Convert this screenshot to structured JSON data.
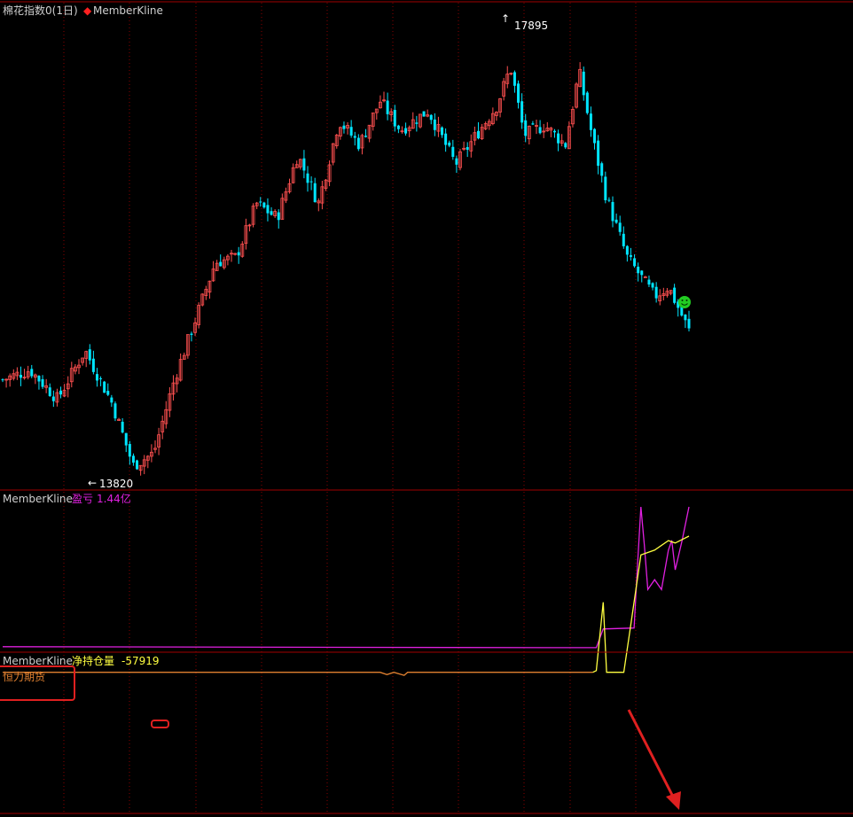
{
  "header": {
    "instrument": "棉花指数0(1日)",
    "indicator_marker": "◆",
    "indicator_name": "MemberKline"
  },
  "price_panel": {
    "high_label": "17895",
    "low_label": "13820",
    "smile_icon": "smiley-face-icon"
  },
  "pnl_panel": {
    "indicator": "MemberKline",
    "label": "盈亏",
    "value": "1.44亿"
  },
  "position_panel": {
    "indicator": "MemberKline",
    "label": "净持仓量",
    "value": "-57919",
    "broker_name": "恒力期货"
  },
  "colors": {
    "up": "#ff5050",
    "down": "#00e5ff",
    "pnl_line": "#e020e0",
    "position_line": "#ffff40",
    "position_line_early": "#e08030",
    "grid": "#8a0000",
    "separator": "#a00000",
    "annotation": "#e02020",
    "smiley": "#22cc22"
  },
  "chart_data": [
    {
      "type": "candlestick",
      "title": "棉花指数0(1日)",
      "ylim": [
        13600,
        18400
      ],
      "annotations": [
        {
          "label": "17895",
          "value": 17895
        },
        {
          "label": "13820",
          "value": 13820
        }
      ],
      "close_path": [
        [
          0,
          14700
        ],
        [
          0.04,
          14800
        ],
        [
          0.08,
          14500
        ],
        [
          0.12,
          15000
        ],
        [
          0.16,
          14450
        ],
        [
          0.19,
          13820
        ],
        [
          0.22,
          13950
        ],
        [
          0.25,
          14700
        ],
        [
          0.28,
          15300
        ],
        [
          0.31,
          15900
        ],
        [
          0.34,
          15950
        ],
        [
          0.37,
          16500
        ],
        [
          0.4,
          16350
        ],
        [
          0.43,
          17000
        ],
        [
          0.46,
          16500
        ],
        [
          0.49,
          17350
        ],
        [
          0.52,
          17100
        ],
        [
          0.55,
          17550
        ],
        [
          0.58,
          17250
        ],
        [
          0.62,
          17450
        ],
        [
          0.66,
          16900
        ],
        [
          0.7,
          17300
        ],
        [
          0.72,
          17500
        ],
        [
          0.74,
          17895
        ],
        [
          0.76,
          17200
        ],
        [
          0.79,
          17300
        ],
        [
          0.82,
          17100
        ],
        [
          0.84,
          17850
        ],
        [
          0.86,
          17150
        ],
        [
          0.88,
          16550
        ],
        [
          0.91,
          15950
        ],
        [
          0.93,
          15750
        ],
        [
          0.95,
          15550
        ],
        [
          0.97,
          15650
        ],
        [
          1.0,
          15200
        ]
      ]
    },
    {
      "type": "line",
      "series": [
        {
          "name": "盈亏",
          "last_value": "1.44亿"
        }
      ],
      "points": [
        [
          0,
          0.02
        ],
        [
          0.8,
          0.01
        ],
        [
          0.865,
          0.01
        ],
        [
          0.875,
          0.2
        ],
        [
          0.92,
          0.21
        ],
        [
          0.925,
          0.85
        ],
        [
          0.93,
          1.44
        ],
        [
          0.935,
          1.05
        ],
        [
          0.94,
          0.6
        ],
        [
          0.95,
          0.7
        ],
        [
          0.96,
          0.6
        ],
        [
          0.97,
          1.0
        ],
        [
          0.975,
          1.1
        ],
        [
          0.98,
          0.8
        ],
        [
          0.99,
          1.1
        ],
        [
          1.0,
          1.44
        ]
      ]
    },
    {
      "type": "line",
      "series": [
        {
          "name": "净持仓量",
          "last_value": -57919
        }
      ],
      "points": [
        [
          0,
          -500
        ],
        [
          0.55,
          -500
        ],
        [
          0.56,
          500
        ],
        [
          0.57,
          -500
        ],
        [
          0.585,
          800
        ],
        [
          0.59,
          -500
        ],
        [
          0.86,
          -500
        ],
        [
          0.865,
          -1200
        ],
        [
          0.875,
          -30000
        ],
        [
          0.88,
          -500
        ],
        [
          0.905,
          -500
        ],
        [
          0.915,
          -20000
        ],
        [
          0.93,
          -50000
        ],
        [
          0.95,
          -52000
        ],
        [
          0.97,
          -56000
        ],
        [
          0.98,
          -55000
        ],
        [
          1.0,
          -57919
        ]
      ]
    }
  ]
}
